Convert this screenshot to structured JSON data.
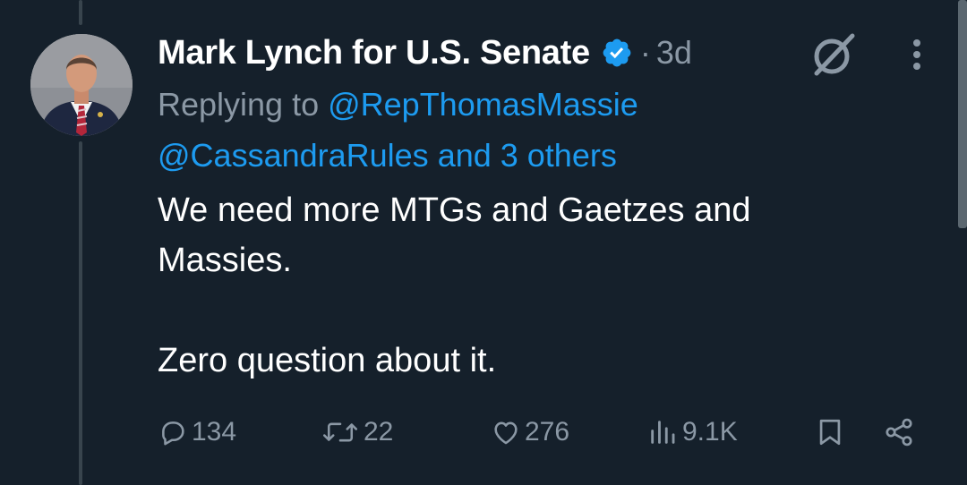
{
  "tweet": {
    "author_name": "Mark Lynch for U.S. Senate",
    "verified": true,
    "separator": "·",
    "time": "3d",
    "replying_prefix": "Replying to ",
    "replying_handle_1": "@RepThomasMassie",
    "replying_handle_2": "@CassandraRules",
    "replying_others": " and 3 others",
    "body_line_1": "We need more MTGs and Gaetzes and",
    "body_line_2": "Massies.",
    "body_line_3": "Zero question about it."
  },
  "actions": {
    "replies": "134",
    "reposts": "22",
    "likes": "276",
    "views": "9.1K"
  },
  "icons": {
    "verified": "verified-badge-icon",
    "grok": "grok-icon",
    "more": "more-vertical-icon",
    "reply": "reply-icon",
    "repost": "repost-icon",
    "like": "heart-icon",
    "views": "views-icon",
    "bookmark": "bookmark-icon",
    "share": "share-icon"
  },
  "colors": {
    "background": "#15202b",
    "text": "#ffffff",
    "muted": "#8b98a5",
    "link": "#1d9bf0",
    "thread_line": "#38444d"
  }
}
